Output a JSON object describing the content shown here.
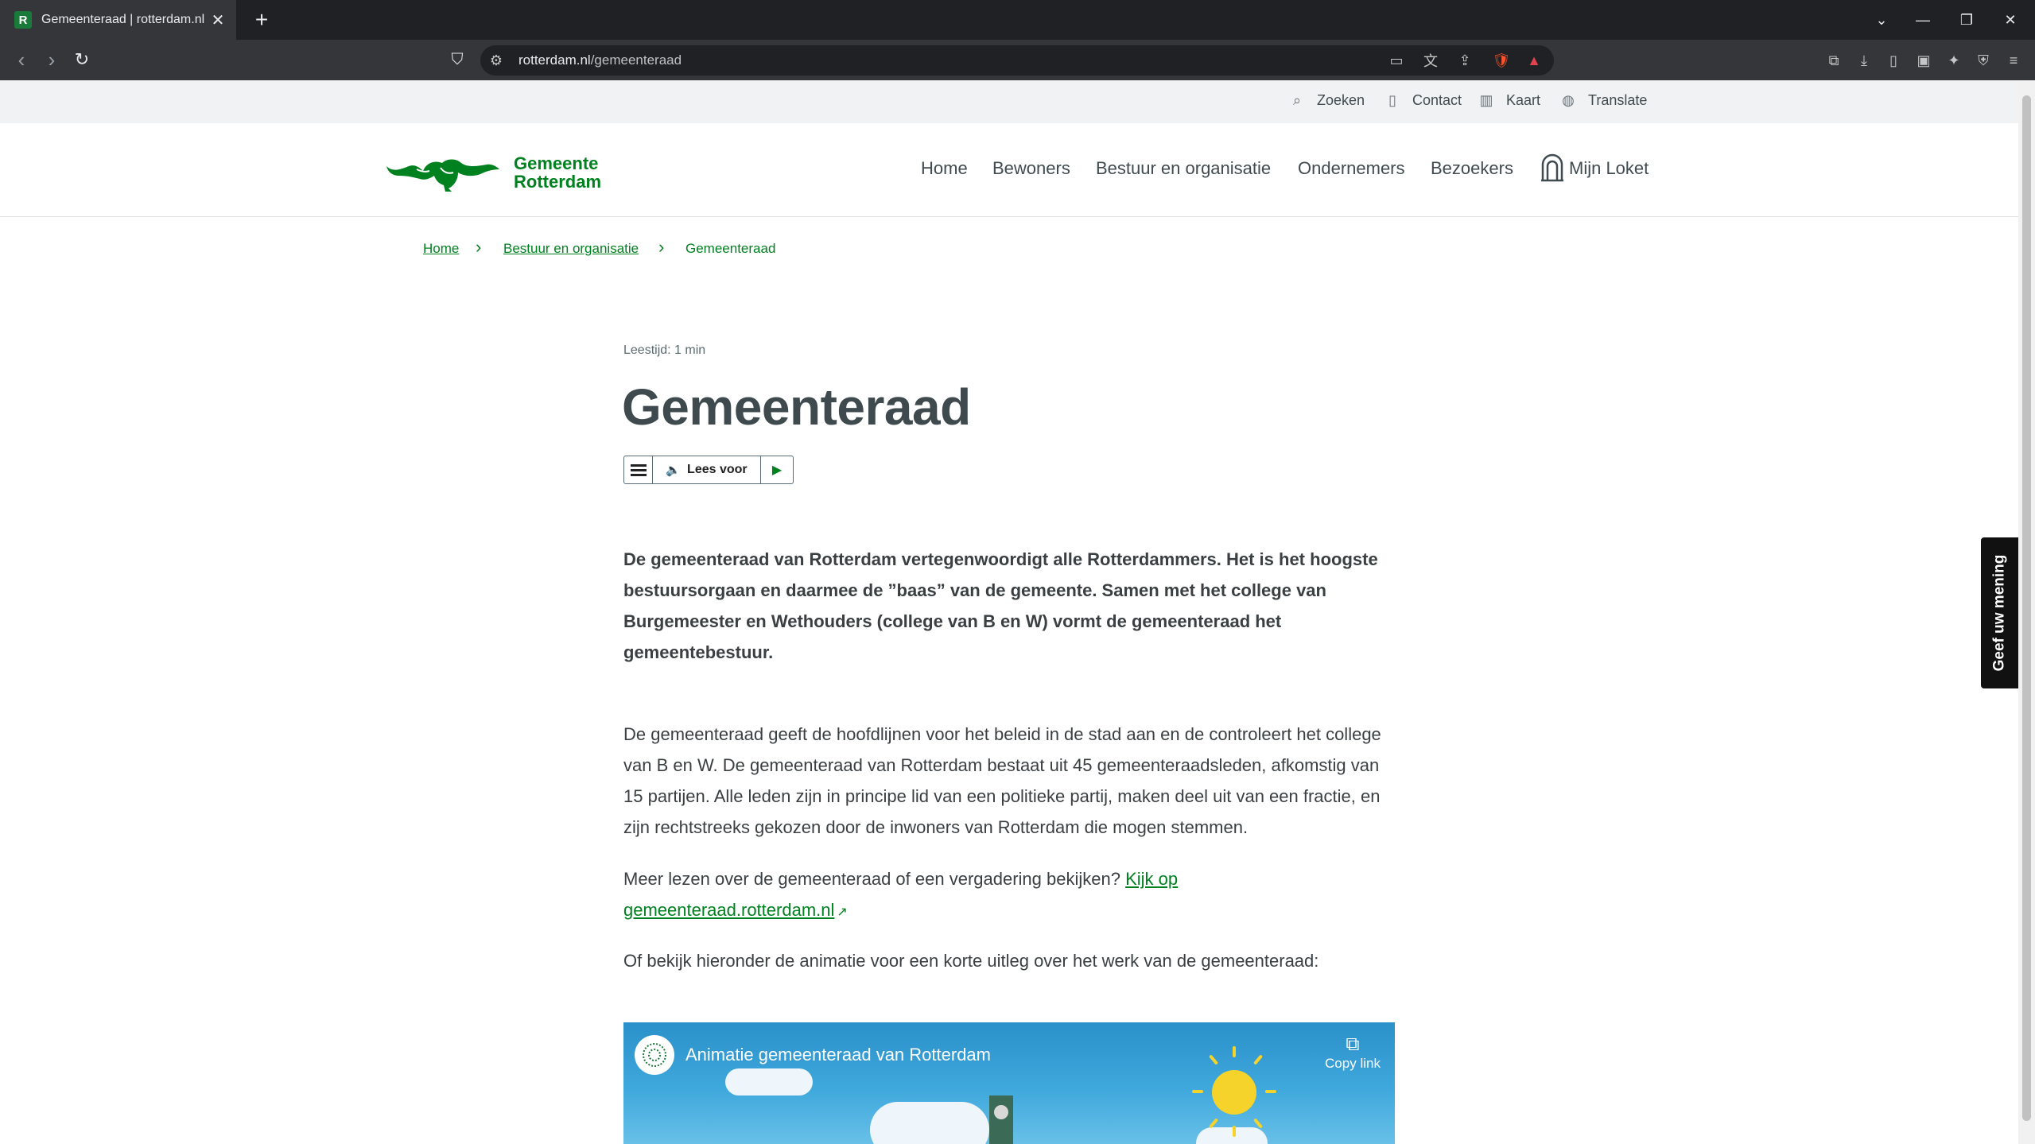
{
  "browser": {
    "tab_title": "Gemeenteraad | rotterdam.nl",
    "url_host": "rotterdam.nl",
    "url_path": "/gemeenteraad"
  },
  "utility_nav": {
    "search": "Zoeken",
    "contact": "Contact",
    "map": "Kaart",
    "translate": "Translate"
  },
  "logo": {
    "line1": "Gemeente",
    "line2": "Rotterdam"
  },
  "main_nav": {
    "items": [
      "Home",
      "Bewoners",
      "Bestuur en organisatie",
      "Ondernemers",
      "Bezoekers"
    ],
    "loket": "Mijn Loket"
  },
  "breadcrumb": {
    "items": [
      "Home",
      "Bestuur en organisatie"
    ],
    "current": "Gemeenteraad"
  },
  "article": {
    "reading_time": "Leestijd: 1 min",
    "title": "Gemeenteraad",
    "read_aloud": "Lees voor",
    "lead": "De gemeenteraad van Rotterdam vertegenwoordigt alle Rotterdammers. Het is het hoogste bestuursorgaan en daarmee de ”baas” van de gemeente. Samen met het college van Burgemeester en Wethouders (college van B en W) vormt de gemeenteraad het gemeentebestuur.",
    "paragraph1": "De gemeenteraad geeft de hoofdlijnen voor het beleid in de stad aan en de controleert het college van B en W. De gemeenteraad van Rotterdam bestaat uit 45 gemeenteraadsleden, afkomstig van 15 partijen. Alle leden zijn in principe lid van een politieke partij, maken deel uit van een fractie, en zijn rechtstreeks gekozen door de inwoners van Rotterdam die mogen stemmen.",
    "paragraph2_text": "Meer lezen over de gemeenteraad of een vergadering bekijken? ",
    "paragraph2_link": "Kijk op gemeenteraad.rotterdam.nl",
    "paragraph3": "Of bekijk hieronder de animatie voor een korte uitleg over het werk van de gemeenteraad:"
  },
  "video": {
    "title": "Animatie gemeenteraad van Rotterdam",
    "copy_link": "Copy link"
  },
  "feedback_tab": "Geef uw mening",
  "colors": {
    "brand_green": "#00811f",
    "text_dark": "#3a3f42",
    "chrome_dark": "#202124"
  }
}
